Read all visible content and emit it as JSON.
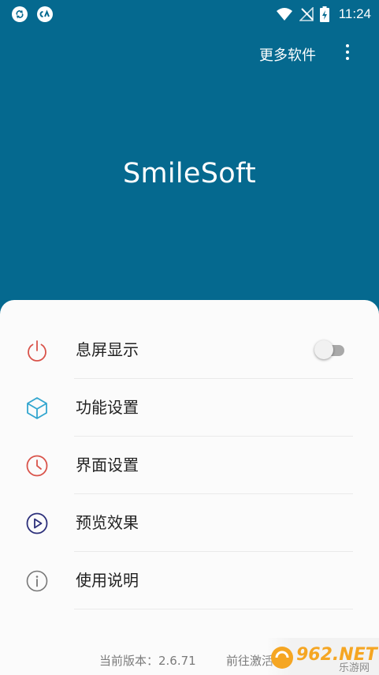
{
  "status_bar": {
    "time": "11:24",
    "left_icons": [
      "sync-icon",
      "cloud-app-icon"
    ],
    "right_icons": [
      "wifi-icon",
      "no-signal-icon",
      "battery-charging-icon"
    ]
  },
  "top_bar": {
    "more_software_label": "更多软件",
    "overflow_icon": "more-vert-icon"
  },
  "app_title": "SmileSoft",
  "menu": [
    {
      "label": "息屏显示",
      "icon": "power-icon",
      "color": "#d9534a",
      "toggle": false
    },
    {
      "label": "功能设置",
      "icon": "cube-icon",
      "color": "#33a6cf"
    },
    {
      "label": "界面设置",
      "icon": "clock-icon",
      "color": "#d9534a"
    },
    {
      "label": "预览效果",
      "icon": "play-icon",
      "color": "#2c2f7a"
    },
    {
      "label": "使用说明",
      "icon": "info-icon",
      "color": "#777777"
    }
  ],
  "footer": {
    "version": "当前版本：2.6.71",
    "activate": "前往激活"
  },
  "watermark": {
    "text": "962.NET",
    "subtext": "乐游网"
  },
  "colors": {
    "header_bg": "#05698f",
    "sheet_bg": "#fbfbfb"
  }
}
